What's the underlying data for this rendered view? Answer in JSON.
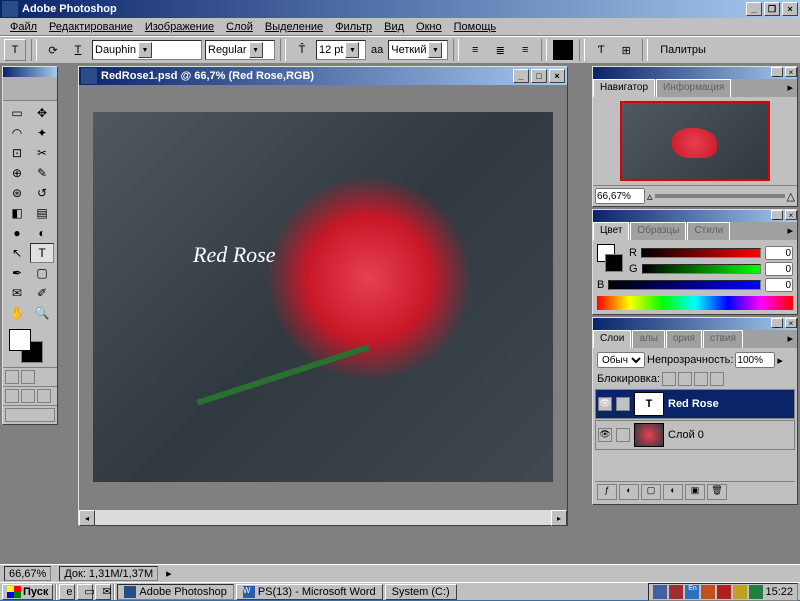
{
  "app": {
    "title": "Adobe Photoshop"
  },
  "menu": [
    "Файл",
    "Редактирование",
    "Изображение",
    "Слой",
    "Выделение",
    "Фильтр",
    "Вид",
    "Окно",
    "Помощь"
  ],
  "options": {
    "font": "Dauphin",
    "style": "Regular",
    "size": "12 pt",
    "aa_label": "aa",
    "aa": "Четкий",
    "palettes_btn": "Палитры"
  },
  "doc": {
    "title": "RedRose1.psd @ 66,7% (Red Rose,RGB)",
    "text_layer": "Red Rose"
  },
  "nav": {
    "tab1": "Навигатор",
    "tab2": "Информация",
    "zoom": "66,67%"
  },
  "color": {
    "tab1": "Цвет",
    "tab2": "Образцы",
    "tab3": "Стили",
    "r_label": "R",
    "g_label": "G",
    "b_label": "B",
    "r": "0",
    "g": "0",
    "b": "0"
  },
  "layers": {
    "tab1": "Слои",
    "tab2": "алы",
    "tab3": "ория",
    "tab4": "ствия",
    "mode_label": "Обыч",
    "mode": "Обыч",
    "opacity_label": "Непрозрачность:",
    "opacity": "100%",
    "lock_label": "Блокировка:",
    "layer1": "Red Rose",
    "layer2": "Слой 0"
  },
  "status": {
    "zoom": "66,67%",
    "doc": "Док: 1,31M/1,37M"
  },
  "taskbar": {
    "start": "Пуск",
    "task1": "Adobe Photoshop",
    "task2": "PS(13) - Microsoft Word",
    "task3": "System (C:)",
    "time": "15:22"
  }
}
